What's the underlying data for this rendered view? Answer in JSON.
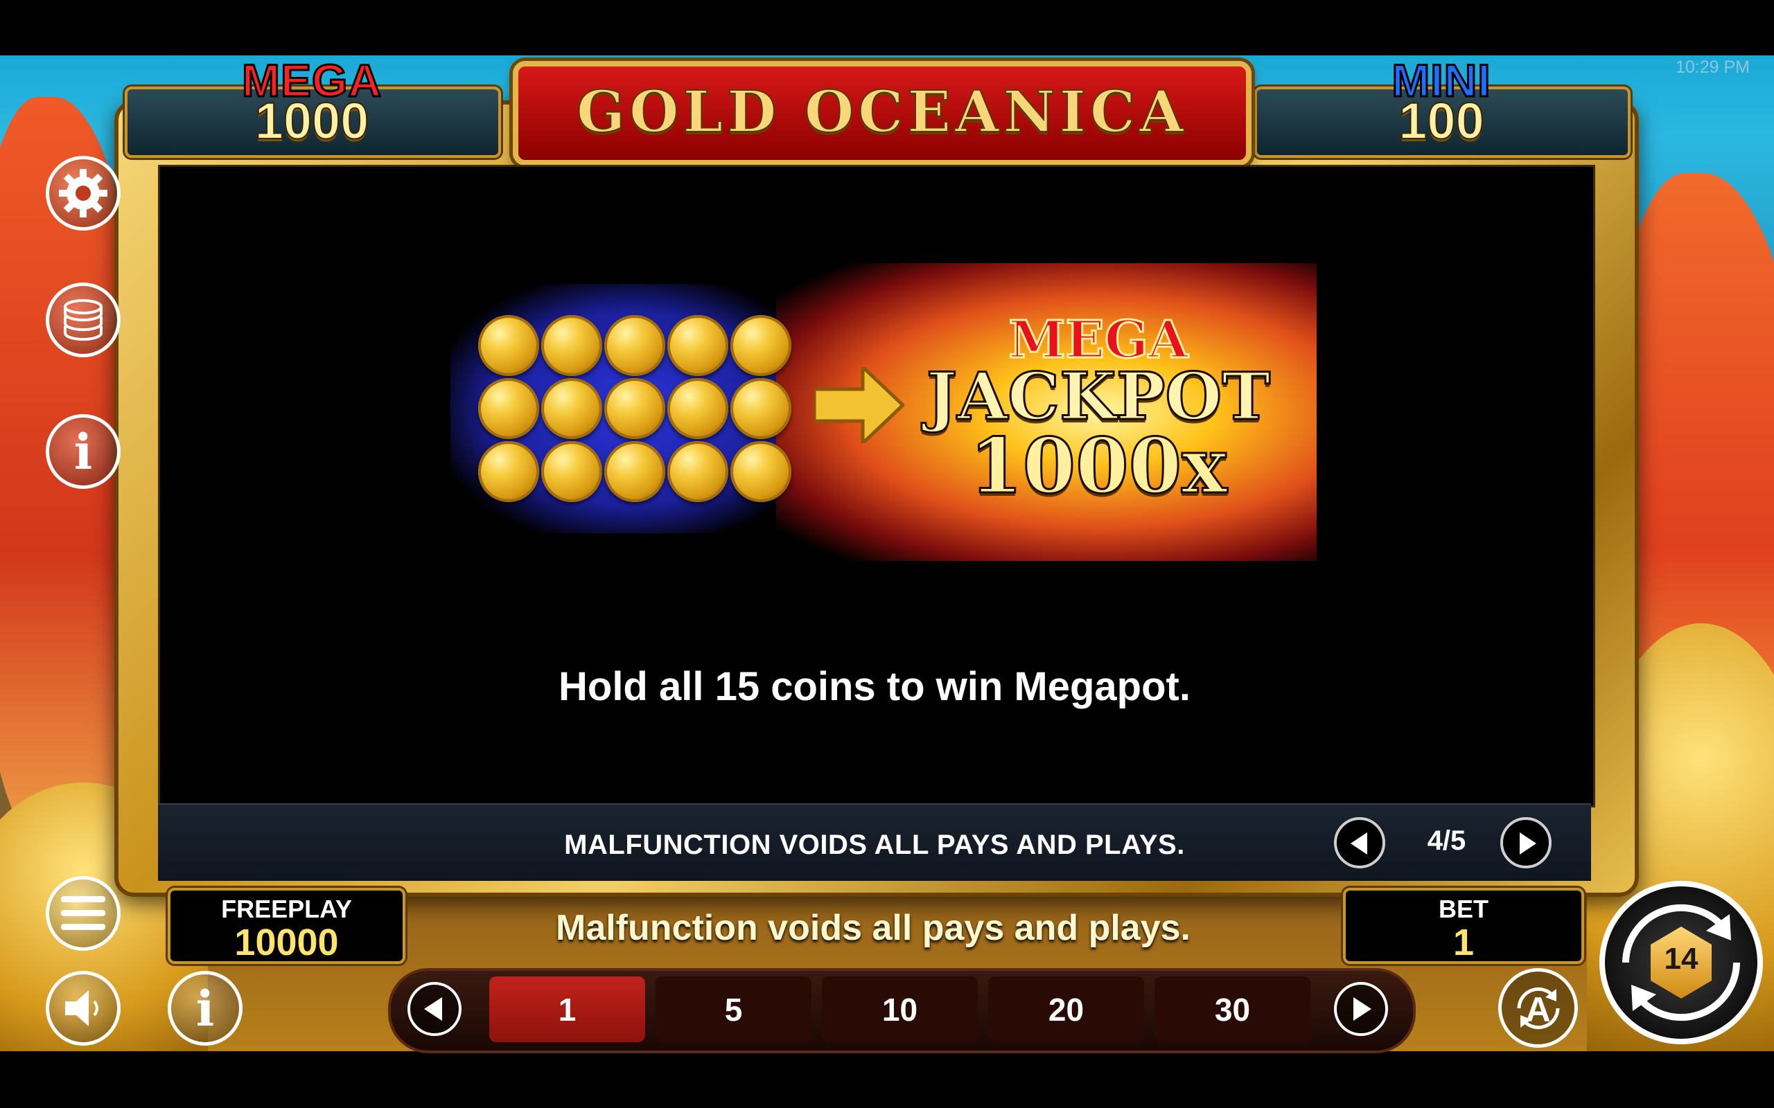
{
  "clock": "10:29 PM",
  "jackpots": {
    "mega": {
      "label": "MEGA",
      "value": "1000"
    },
    "mini": {
      "label": "MINI",
      "value": "100"
    }
  },
  "game_title": "GOLD OCEANICA",
  "side_menu": {
    "settings_icon": "gear-icon",
    "paytable_icon": "coin-stack-icon",
    "info_icon": "info-icon",
    "menu_icon": "hamburger-icon",
    "sound_icon": "speaker-icon",
    "help_icon": "info-icon"
  },
  "help_page": {
    "illustration": {
      "coin_grid": {
        "rows": 3,
        "columns": 5
      },
      "prize_line1": "MEGA",
      "prize_line2": "JACKPOT",
      "prize_line3": "1000x"
    },
    "description": "Hold all 15 coins to win Megapot.",
    "disclaimer": "MALFUNCTION VOIDS ALL PAYS AND PLAYS.",
    "pager": {
      "current": "4/5"
    }
  },
  "footer_message": "Malfunction voids all pays and plays.",
  "freeplay": {
    "label": "FREEPLAY",
    "value": "10000"
  },
  "bet": {
    "label": "BET",
    "value": "1"
  },
  "bet_options": [
    "1",
    "5",
    "10",
    "20",
    "30"
  ],
  "selected_bet_index": 0,
  "buttons": {
    "spin_badge": "14",
    "auto_label": "A"
  }
}
